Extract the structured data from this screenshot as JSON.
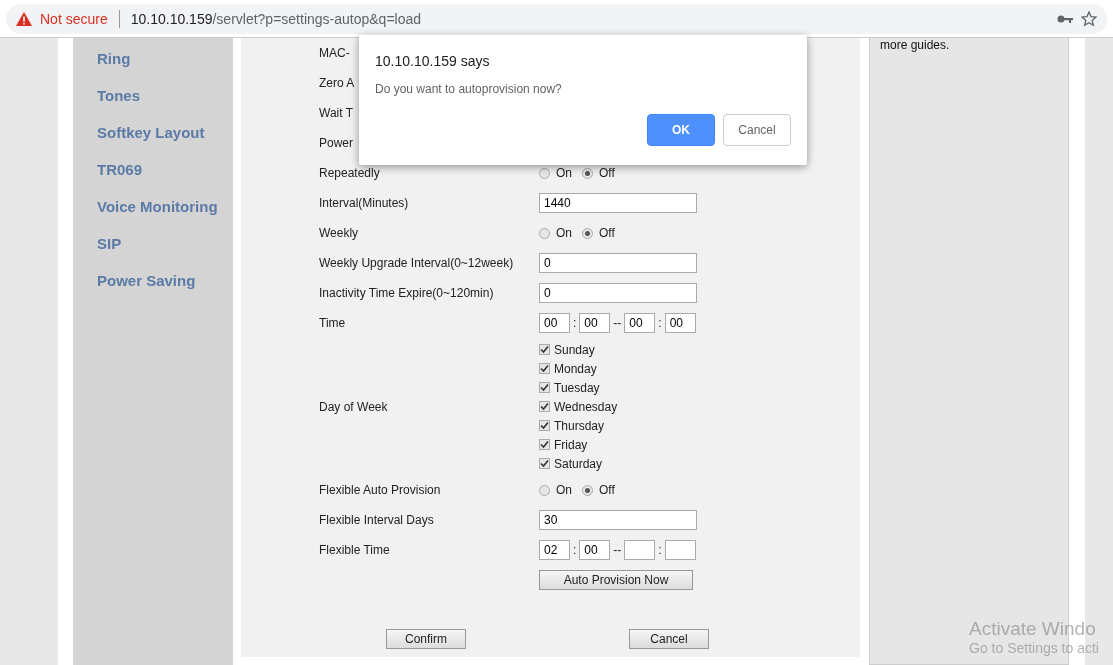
{
  "address_bar": {
    "security": "Not secure",
    "host": "10.10.10.159",
    "path": "/servlet?p=settings-autop&q=load"
  },
  "sidebar": {
    "items": [
      {
        "label": "Ring"
      },
      {
        "label": "Tones"
      },
      {
        "label": "Softkey Layout"
      },
      {
        "label": "TR069"
      },
      {
        "label": "Voice Monitoring"
      },
      {
        "label": "SIP"
      },
      {
        "label": "Power Saving"
      }
    ]
  },
  "form": {
    "rows": [
      {
        "kind": "label",
        "label": "MAC-"
      },
      {
        "kind": "label",
        "label": "Zero A"
      },
      {
        "kind": "label",
        "label": "Wait T"
      },
      {
        "kind": "label",
        "label": "Power"
      },
      {
        "kind": "radio",
        "label": "Repeatedly",
        "options": [
          {
            "label": "On",
            "selected": false
          },
          {
            "label": "Off",
            "selected": true
          }
        ]
      },
      {
        "kind": "text",
        "label": "Interval(Minutes)",
        "value": "1440"
      },
      {
        "kind": "radio",
        "label": "Weekly",
        "options": [
          {
            "label": "On",
            "selected": false
          },
          {
            "label": "Off",
            "selected": true
          }
        ]
      },
      {
        "kind": "text",
        "label": "Weekly Upgrade Interval(0~12week)",
        "value": "0"
      },
      {
        "kind": "text",
        "label": "Inactivity Time Expire(0~120min)",
        "value": "0"
      },
      {
        "kind": "time",
        "label": "Time",
        "fields": [
          "00",
          "00",
          "00",
          "00"
        ],
        "separators": [
          ":",
          "--",
          ":"
        ]
      },
      {
        "kind": "checks",
        "label": "Day of Week",
        "days": [
          {
            "label": "Sunday",
            "checked": true
          },
          {
            "label": "Monday",
            "checked": true
          },
          {
            "label": "Tuesday",
            "checked": true
          },
          {
            "label": "Wednesday",
            "checked": true
          },
          {
            "label": "Thursday",
            "checked": true
          },
          {
            "label": "Friday",
            "checked": true
          },
          {
            "label": "Saturday",
            "checked": true
          }
        ]
      },
      {
        "kind": "radio",
        "label": "Flexible Auto Provision",
        "options": [
          {
            "label": "On",
            "selected": false
          },
          {
            "label": "Off",
            "selected": true
          }
        ]
      },
      {
        "kind": "text",
        "label": "Flexible Interval Days",
        "value": "30"
      },
      {
        "kind": "time",
        "label": "Flexible Time",
        "fields": [
          "02",
          "00"
        ],
        "separators": [
          ":",
          "--",
          ":"
        ]
      },
      {
        "kind": "button",
        "label": "Auto Provision Now"
      }
    ]
  },
  "actions": [
    {
      "label": "Confirm"
    },
    {
      "label": "Cancel"
    }
  ],
  "right_panel": {
    "text": "more guides."
  },
  "dialog": {
    "title": "10.10.10.159 says",
    "message": "Do you want to autoprovision now?",
    "buttons": [
      {
        "label": "OK",
        "default": true
      },
      {
        "label": "Cancel",
        "default": false
      }
    ]
  },
  "os_watermark": {
    "lines": [
      "Activate Windo",
      "Go to Settings to acti"
    ]
  }
}
